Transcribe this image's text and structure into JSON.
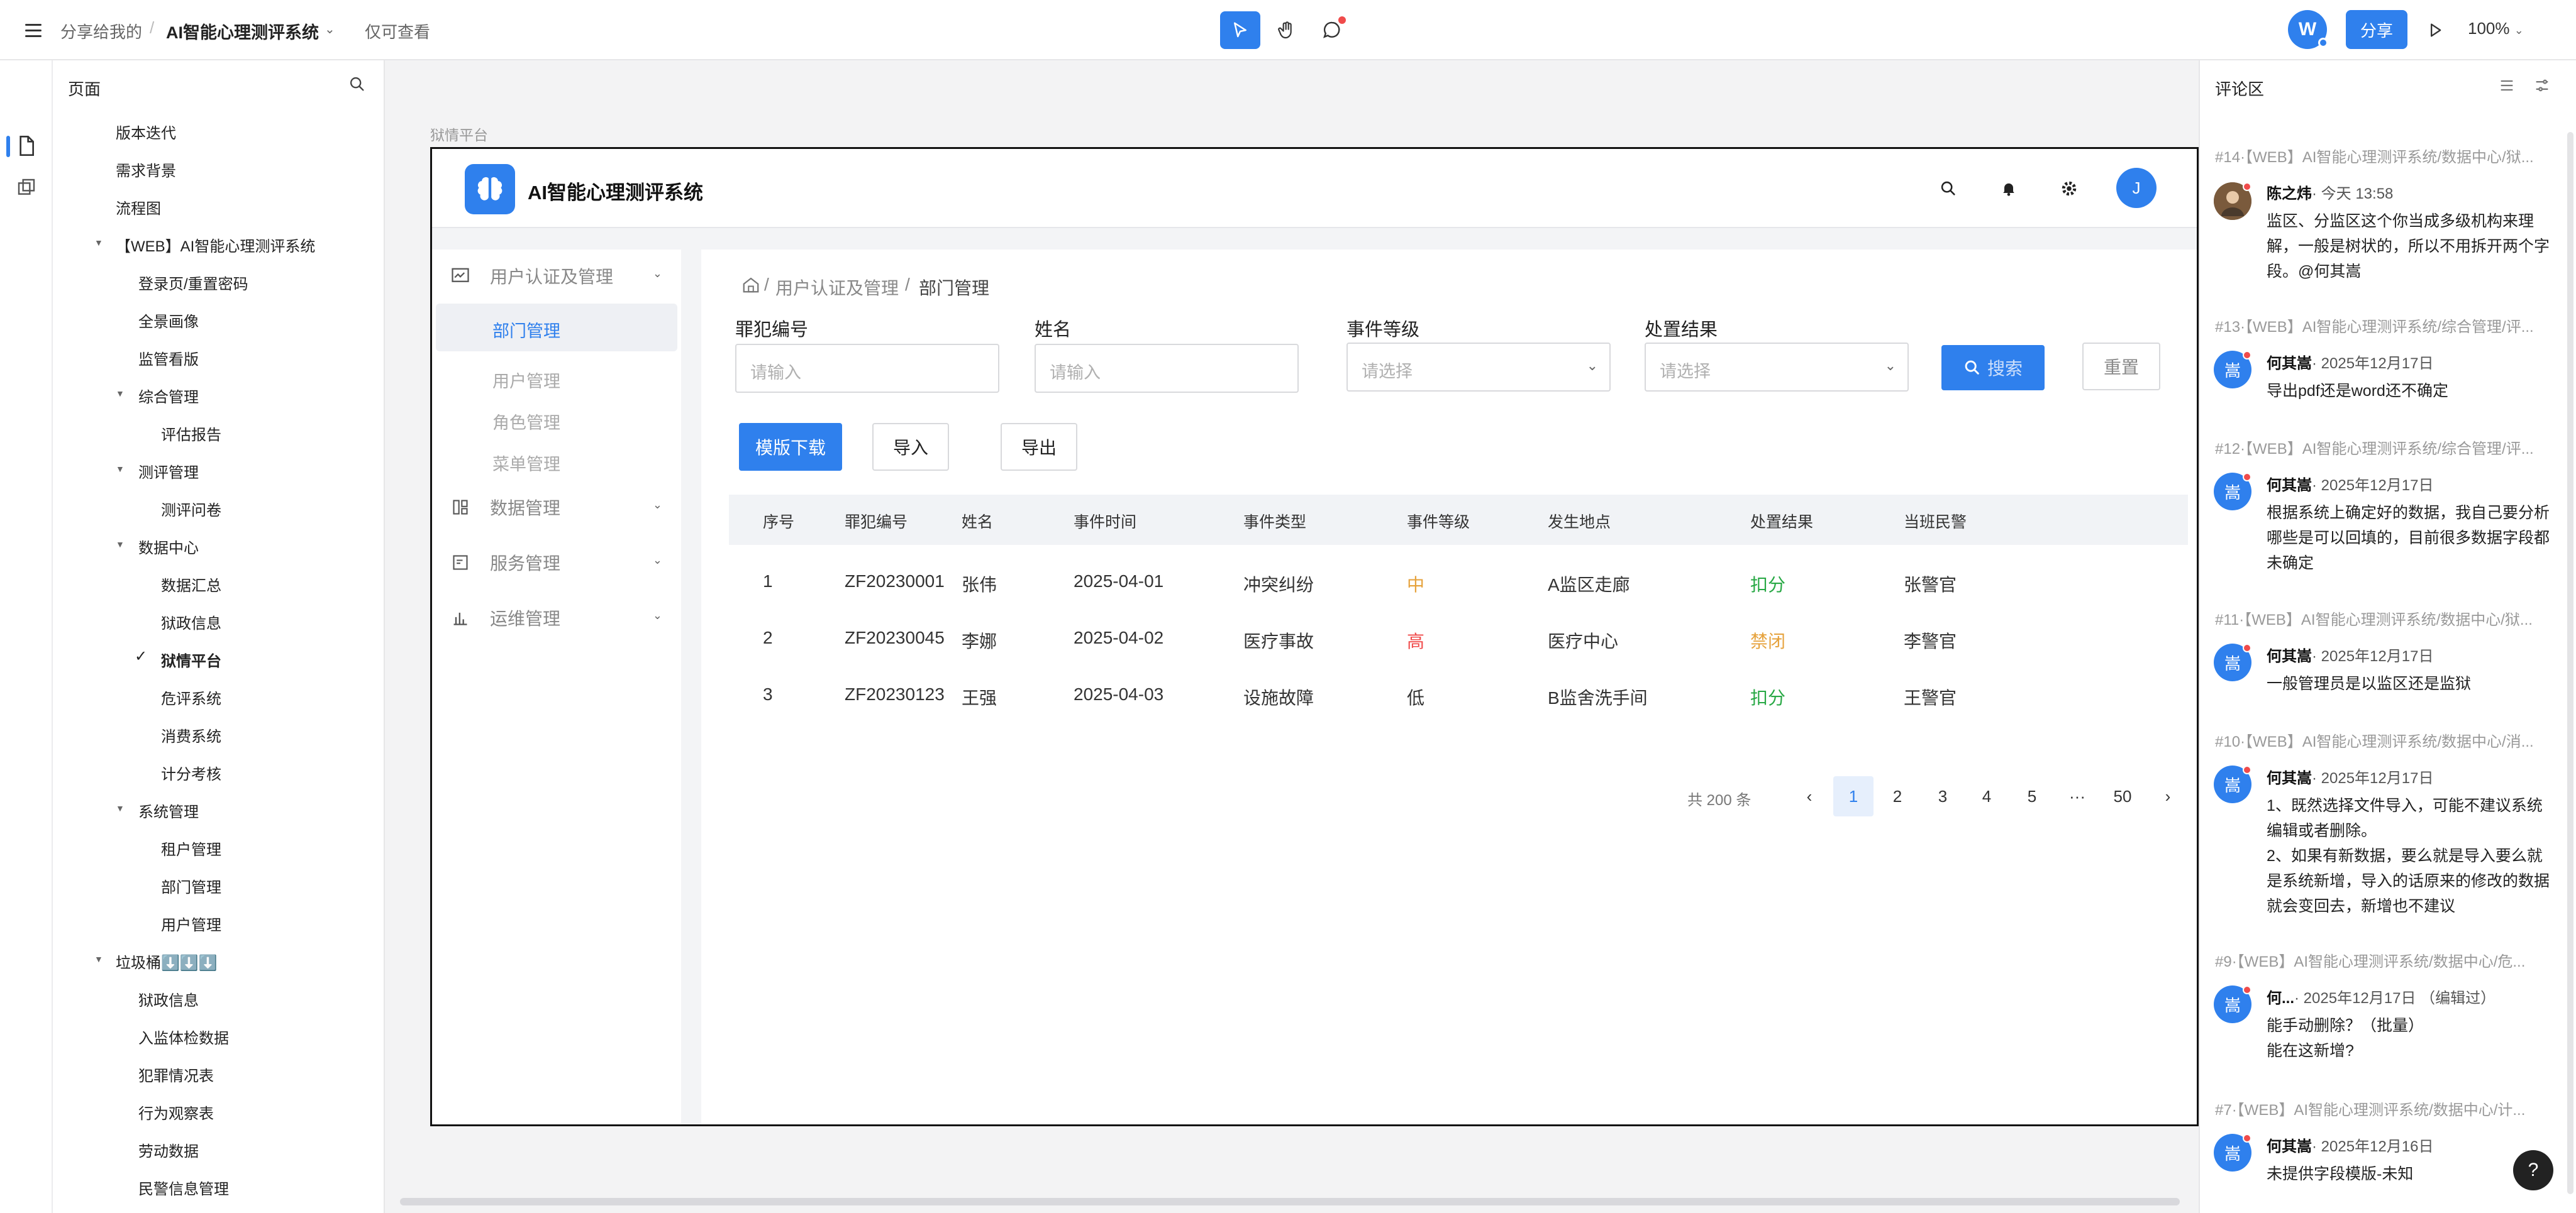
{
  "topbar": {
    "crumb_shared": "分享给我的",
    "crumb_sep": "/",
    "crumb_project": "AI智能心理测评系统",
    "readonly": "仅可查看",
    "share": "分享",
    "avatar": "W",
    "zoom": "100%"
  },
  "pages": {
    "title": "页面",
    "items": [
      {
        "label": "版本迭代"
      },
      {
        "label": "需求背景"
      },
      {
        "label": "流程图"
      },
      {
        "label": "【WEB】AI智能心理测评系统"
      },
      {
        "label": "登录页/重置密码"
      },
      {
        "label": "全景画像"
      },
      {
        "label": "监管看版"
      },
      {
        "label": "综合管理"
      },
      {
        "label": "评估报告"
      },
      {
        "label": "测评管理"
      },
      {
        "label": "测评问卷"
      },
      {
        "label": "数据中心"
      },
      {
        "label": "数据汇总"
      },
      {
        "label": "狱政信息"
      },
      {
        "label": "狱情平台"
      },
      {
        "label": "危评系统"
      },
      {
        "label": "消费系统"
      },
      {
        "label": "计分考核"
      },
      {
        "label": "系统管理"
      },
      {
        "label": "租户管理"
      },
      {
        "label": "部门管理"
      },
      {
        "label": "用户管理"
      },
      {
        "label": "垃圾桶⬇️⬇️⬇️"
      },
      {
        "label": "狱政信息"
      },
      {
        "label": "入监体检数据"
      },
      {
        "label": "犯罪情况表"
      },
      {
        "label": "行为观察表"
      },
      {
        "label": "劳动数据"
      },
      {
        "label": "民警信息管理"
      }
    ]
  },
  "canvas": {
    "frame_label": "狱情平台",
    "app_title": "AI智能心理测评系统",
    "user_initial": "J",
    "sidebar": {
      "group1": "用户认证及管理",
      "subs": [
        "部门管理",
        "用户管理",
        "角色管理",
        "菜单管理"
      ],
      "group2": "数据管理",
      "group3": "服务管理",
      "group4": "运维管理"
    },
    "breadcrumb": {
      "b1": "用户认证及管理",
      "b2": "部门管理"
    },
    "filters": {
      "f1_label": "罪犯编号",
      "f1_placeholder": "请输入",
      "f2_label": "姓名",
      "f2_placeholder": "请输入",
      "f3_label": "事件等级",
      "f3_placeholder": "请选择",
      "f4_label": "处置结果",
      "f4_placeholder": "请选择",
      "search": "搜索",
      "reset": "重置"
    },
    "actions": {
      "download": "模版下载",
      "import": "导入",
      "export": "导出"
    },
    "table": {
      "headers": [
        "序号",
        "罪犯编号",
        "姓名",
        "事件时间",
        "事件类型",
        "事件等级",
        "发生地点",
        "处置结果",
        "当班民警"
      ],
      "rows": [
        [
          "1",
          "ZF20230001",
          "张伟",
          "2025-04-01",
          "冲突纠纷",
          "中",
          "A监区走廊",
          "扣分",
          "张警官"
        ],
        [
          "2",
          "ZF20230045",
          "李娜",
          "2025-04-02",
          "医疗事故",
          "高",
          "医疗中心",
          "禁闭",
          "李警官"
        ],
        [
          "3",
          "ZF20230123",
          "王强",
          "2025-04-03",
          "设施故障",
          "低",
          "B监舍洗手间",
          "扣分",
          "王警官"
        ]
      ],
      "level_colors": {
        "中": "#e6a23c",
        "高": "#f04b4b",
        "低": "#333333"
      },
      "result_colors": {
        "扣分": "#27a844",
        "禁闭": "#e6a23c"
      }
    },
    "pagination": {
      "total": "共 200 条",
      "prev": "‹",
      "pages": [
        "1",
        "2",
        "3",
        "4",
        "5",
        "···",
        "50"
      ],
      "next": "›",
      "current": "1"
    }
  },
  "comments": {
    "title": "评论区",
    "items": [
      {
        "ref": "#14·【WEB】AI智能心理测评系统/数据中心/狱...",
        "author": "陈之炜",
        "time": "· 今天 13:58",
        "text": "监区、分监区这个你当成多级机构来理解，一般是树状的，所以不用拆开两个字段。@何其嵩"
      },
      {
        "ref": "#13·【WEB】AI智能心理测评系统/综合管理/评...",
        "author": "何其嵩",
        "time": "· 2025年12月17日",
        "text": "导出pdf还是word还不确定"
      },
      {
        "ref": "#12·【WEB】AI智能心理测评系统/综合管理/评...",
        "author": "何其嵩",
        "time": "· 2025年12月17日",
        "text": "根据系统上确定好的数据，我自己要分析哪些是可以回填的，目前很多数据字段都未确定"
      },
      {
        "ref": "#11·【WEB】AI智能心理测评系统/数据中心/狱...",
        "author": "何其嵩",
        "time": "· 2025年12月17日",
        "text": "一般管理员是以监区还是监狱"
      },
      {
        "ref": "#10·【WEB】AI智能心理测评系统/数据中心/消...",
        "author": "何其嵩",
        "time": "· 2025年12月17日",
        "text": "1、既然选择文件导入，可能不建议系统编辑或者删除。\n2、如果有新数据，要么就是导入要么就是系统新增，导入的话原来的修改的数据就会变回去，新增也不建议"
      },
      {
        "ref": "#9·【WEB】AI智能心理测评系统/数据中心/危...",
        "author": "何...",
        "time": "· 2025年12月17日 （编辑过）",
        "text": "能手动删除？（批量）\n能在这新增?"
      },
      {
        "ref": "#7·【WEB】AI智能心理测评系统/数据中心/计...",
        "author": "何其嵩",
        "time": "· 2025年12月16日",
        "text": "未提供字段模版-未知"
      }
    ],
    "avatar_char": "嵩"
  },
  "help": "?"
}
